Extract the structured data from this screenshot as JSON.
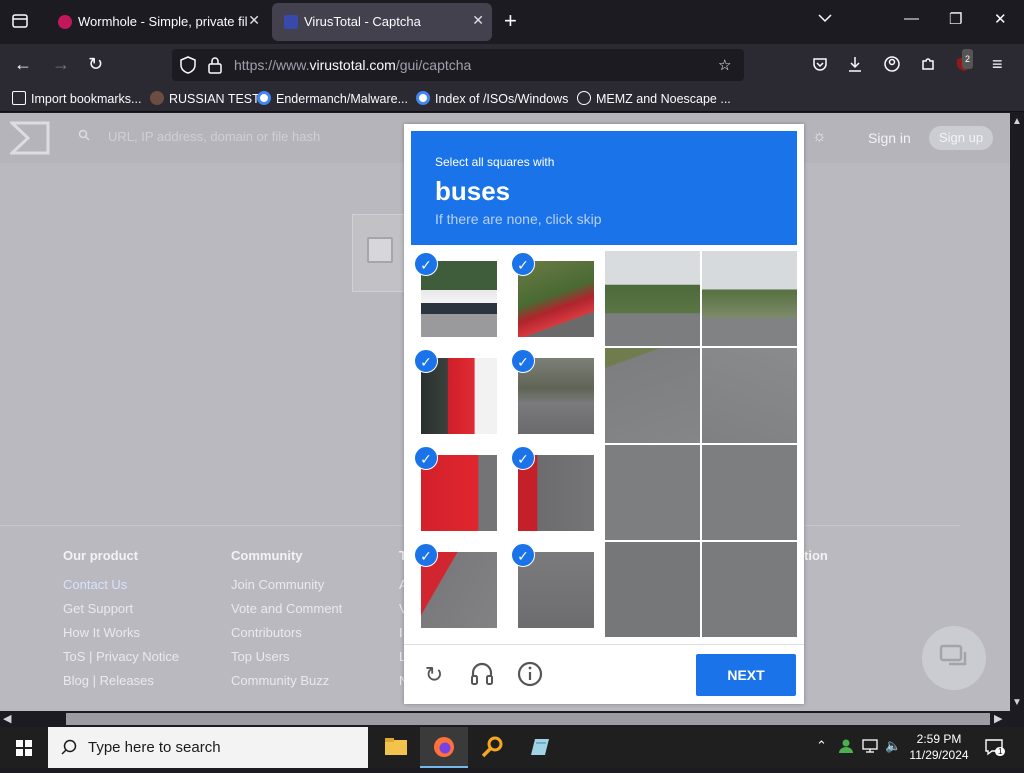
{
  "browser": {
    "tabs": [
      {
        "title": "Wormhole - Simple, private file",
        "active": false
      },
      {
        "title": "VirusTotal - Captcha",
        "active": true
      }
    ],
    "url_base": "https://www.",
    "url_host": "virustotal.com",
    "url_path": "/gui/captcha",
    "bookmarks": [
      "Import bookmarks...",
      "RUSSIAN TEST",
      "Endermanch/Malware...",
      "Index of /ISOs/Windows",
      "MEMZ and Noescape ..."
    ],
    "extension_badge": "2"
  },
  "virustotal": {
    "search_placeholder": "URL, IP address, domain or file hash",
    "sign_in": "Sign in",
    "sign_up": "Sign up",
    "footer": {
      "col1": {
        "heading": "Our product",
        "links": [
          "Contact Us",
          "Get Support",
          "How It Works",
          "ToS | Privacy Notice",
          "Blog | Releases"
        ]
      },
      "col2": {
        "heading": "Community",
        "links": [
          "Join Community",
          "Vote and Comment",
          "Contributors",
          "Top Users",
          "Community Buzz"
        ]
      },
      "col3_partial": [
        "T",
        "A",
        "V",
        "I",
        "L",
        "N"
      ],
      "col4_partial_heading": "tion"
    }
  },
  "captcha": {
    "instruction": "Select all squares with",
    "target": "buses",
    "hint": "If there are none, click skip",
    "next_label": "NEXT",
    "selected_tiles": 8,
    "icons": [
      "reload-icon",
      "audio-icon",
      "info-icon"
    ]
  },
  "taskbar": {
    "search_placeholder": "Type here to search",
    "time": "2:59 PM",
    "date": "11/29/2024",
    "notification_count": "1"
  },
  "colors": {
    "captcha_blue": "#1a73e8",
    "browser_dark": "#1c1b22",
    "page_overlay": "#b9b9bf"
  }
}
